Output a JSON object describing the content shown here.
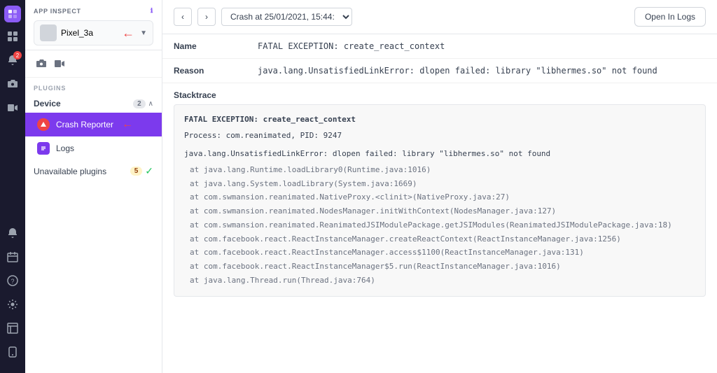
{
  "iconBar": {
    "appLogo": "□",
    "icons": [
      {
        "name": "grid-icon",
        "symbol": "⊞",
        "badge": null
      },
      {
        "name": "bell-icon",
        "symbol": "🔔",
        "badge": "2"
      },
      {
        "name": "camera-icon",
        "symbol": "📷",
        "badge": null
      },
      {
        "name": "phone-icon",
        "symbol": "📱",
        "badge": null
      }
    ],
    "bottomIcons": [
      {
        "name": "bell-bottom-icon",
        "symbol": "🔔",
        "badge": null
      },
      {
        "name": "calendar-icon",
        "symbol": "📅",
        "badge": null
      },
      {
        "name": "question-icon",
        "symbol": "?",
        "badge": null
      },
      {
        "name": "settings-icon",
        "symbol": "⚙",
        "badge": null
      },
      {
        "name": "layout-icon",
        "symbol": "▦",
        "badge": null
      },
      {
        "name": "device-icon",
        "symbol": "▣",
        "badge": null
      }
    ]
  },
  "sidebar": {
    "sectionLabel": "APP INSPECT",
    "infoIcon": "ℹ",
    "deviceSelector": {
      "name": "Pixel_3a",
      "arrow": "▼"
    },
    "pluginsLabel": "PLUGINS",
    "deviceGroup": {
      "title": "Device",
      "count": "2",
      "expanded": true
    },
    "items": [
      {
        "id": "crash-reporter",
        "label": "Crash Reporter",
        "active": true
      },
      {
        "id": "logs",
        "label": "Logs",
        "active": false
      }
    ],
    "unavailable": {
      "label": "Unavailable plugins",
      "count": "5"
    }
  },
  "main": {
    "toolbar": {
      "backLabel": "‹",
      "forwardLabel": "›",
      "crashSelector": "Crash at 25/01/2021, 15:44:",
      "openLogsButton": "Open In Logs"
    },
    "crashReport": {
      "nameLabel": "Name",
      "nameValue": "FATAL EXCEPTION: create_react_context",
      "reasonLabel": "Reason",
      "reasonValue": "java.lang.UnsatisfiedLinkError: dlopen failed: library \"libhermes.so\" not found",
      "stacktraceLabel": "Stacktrace",
      "stacktraceLines": [
        {
          "type": "fatal",
          "text": "FATAL EXCEPTION: create_react_context"
        },
        {
          "type": "process",
          "text": "Process: com.reanimated, PID: 9247"
        },
        {
          "type": "error",
          "text": "java.lang.UnsatisfiedLinkError: dlopen failed: library \"libhermes.so\" not found"
        },
        {
          "type": "at",
          "text": "at java.lang.Runtime.loadLibrary0(Runtime.java:1016)"
        },
        {
          "type": "at",
          "text": "at java.lang.System.loadLibrary(System.java:1669)"
        },
        {
          "type": "at",
          "text": "at com.swmansion.reanimated.NativeProxy.<clinit>(NativeProxy.java:27)"
        },
        {
          "type": "at",
          "text": "at com.swmansion.reanimated.NodesManager.initWithContext(NodesManager.java:127)"
        },
        {
          "type": "at",
          "text": "at com.swmansion.reanimated.ReanimatedJSIModulePackage.getJSIModules(ReanimatedJSIModulePackage.java:18)"
        },
        {
          "type": "at",
          "text": "at com.facebook.react.ReactInstanceManager.createReactContext(ReactInstanceManager.java:1256)"
        },
        {
          "type": "at",
          "text": "at com.facebook.react.ReactInstanceManager.access$1100(ReactInstanceManager.java:131)"
        },
        {
          "type": "at",
          "text": "at com.facebook.react.ReactInstanceManager$5.run(ReactInstanceManager.java:1016)"
        },
        {
          "type": "at",
          "text": "at java.lang.Thread.run(Thread.java:764)"
        }
      ]
    }
  }
}
